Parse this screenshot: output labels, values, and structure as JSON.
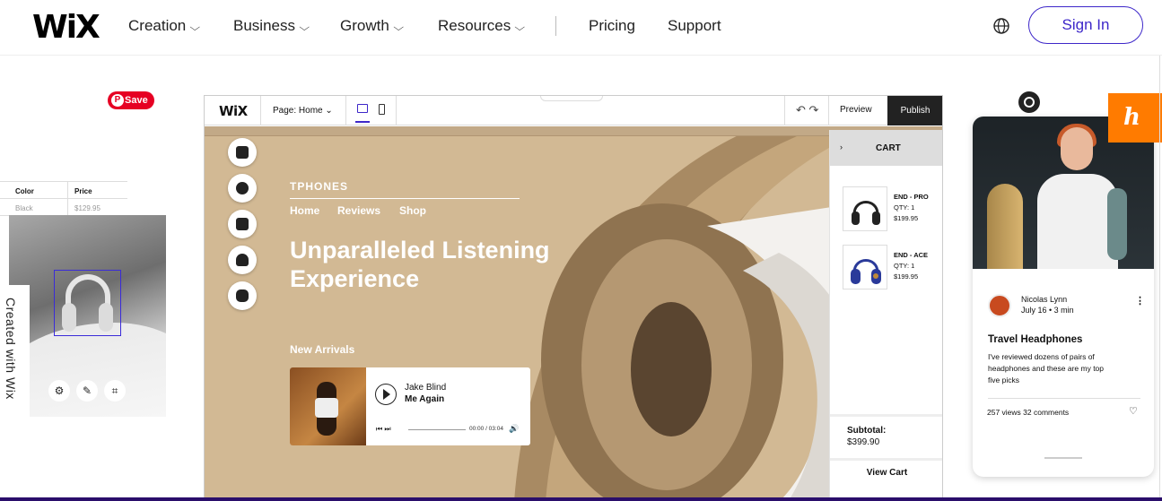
{
  "header": {
    "logo": "WiX",
    "nav": [
      {
        "label": "Creation",
        "has_menu": true
      },
      {
        "label": "Business",
        "has_menu": true
      },
      {
        "label": "Growth",
        "has_menu": true
      },
      {
        "label": "Resources",
        "has_menu": true
      },
      {
        "label": "Pricing",
        "has_menu": false
      },
      {
        "label": "Support",
        "has_menu": false
      }
    ],
    "chevron": "⌵",
    "globe_icon": "globe-icon",
    "sign_in": "Sign In",
    "accent": "#3d27c9"
  },
  "left_panel": {
    "pinterest_save": "Save",
    "pinterest_glyph": "P",
    "table": {
      "headers": [
        "Color",
        "Price"
      ],
      "row": [
        "Black",
        "$129.95"
      ]
    },
    "tool_icons": [
      "gear-icon",
      "pen-icon",
      "crop-icon"
    ],
    "tool_glyphs": [
      "⚙",
      "✎",
      "⌗"
    ],
    "created_with": "Created with Wix"
  },
  "editor": {
    "logo": "WiX",
    "page_select": "Page: Home",
    "page_chevron": "⌄",
    "collapse_glyph": "⌃",
    "undo_redo": "↶ ↷",
    "preview": "Preview",
    "publish": "Publish",
    "site": {
      "brand": "TPHONES",
      "nav": [
        "Home",
        "Reviews",
        "Shop"
      ],
      "hero": "Unparalleled Listening Experience",
      "new_arrivals": "New Arrivals",
      "player": {
        "artist": "Jake Blind",
        "track": "Me Again",
        "controls": "⏮ ⏭",
        "time": "00:00 / 03:04",
        "volume": "🔊"
      }
    },
    "side_tools": [
      "pages-icon",
      "add-icon",
      "apps-icon",
      "upload-icon",
      "database-icon"
    ],
    "cart": {
      "title": "CART",
      "arrow": "›",
      "items": [
        {
          "name": "END - PRO",
          "qty": "QTY: 1",
          "price": "$199.95"
        },
        {
          "name": "END - ACE",
          "qty": "QTY: 1",
          "price": "$199.95"
        }
      ],
      "subtotal_label": "Subtotal:",
      "subtotal_value": "$399.90",
      "view_cart": "View Cart"
    }
  },
  "phone": {
    "author": "Nicolas Lynn",
    "date": "July 16 • 3 min",
    "menu_glyph": "⋮",
    "title": "Travel Headphones",
    "body": "I've reviewed dozens of pairs of headphones and these are my top five picks",
    "stats": "257 views   32 comments",
    "heart": "♡"
  },
  "badge_glyph": "h"
}
